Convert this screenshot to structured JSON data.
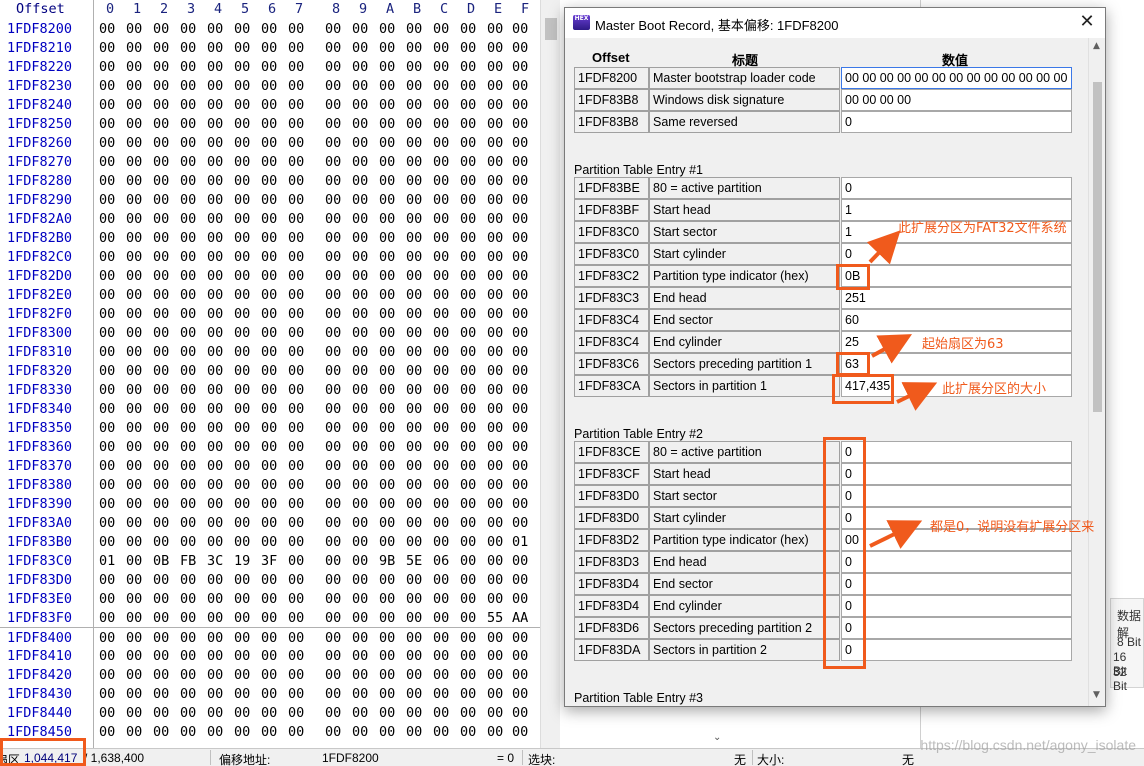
{
  "hex_editor": {
    "offset_header": "Offset",
    "column_headers": [
      "0",
      "1",
      "2",
      "3",
      "4",
      "5",
      "6",
      "7",
      "8",
      "9",
      "A",
      "B",
      "C",
      "D",
      "E",
      "F"
    ],
    "rows": [
      {
        "addr": "1FDF8200",
        "bytes": [
          "00",
          "00",
          "00",
          "00",
          "00",
          "00",
          "00",
          "00",
          "00",
          "00",
          "00",
          "00",
          "00",
          "00",
          "00",
          "00"
        ]
      },
      {
        "addr": "1FDF8210",
        "bytes": [
          "00",
          "00",
          "00",
          "00",
          "00",
          "00",
          "00",
          "00",
          "00",
          "00",
          "00",
          "00",
          "00",
          "00",
          "00",
          "00"
        ]
      },
      {
        "addr": "1FDF8220",
        "bytes": [
          "00",
          "00",
          "00",
          "00",
          "00",
          "00",
          "00",
          "00",
          "00",
          "00",
          "00",
          "00",
          "00",
          "00",
          "00",
          "00"
        ]
      },
      {
        "addr": "1FDF8230",
        "bytes": [
          "00",
          "00",
          "00",
          "00",
          "00",
          "00",
          "00",
          "00",
          "00",
          "00",
          "00",
          "00",
          "00",
          "00",
          "00",
          "00"
        ]
      },
      {
        "addr": "1FDF8240",
        "bytes": [
          "00",
          "00",
          "00",
          "00",
          "00",
          "00",
          "00",
          "00",
          "00",
          "00",
          "00",
          "00",
          "00",
          "00",
          "00",
          "00"
        ]
      },
      {
        "addr": "1FDF8250",
        "bytes": [
          "00",
          "00",
          "00",
          "00",
          "00",
          "00",
          "00",
          "00",
          "00",
          "00",
          "00",
          "00",
          "00",
          "00",
          "00",
          "00"
        ]
      },
      {
        "addr": "1FDF8260",
        "bytes": [
          "00",
          "00",
          "00",
          "00",
          "00",
          "00",
          "00",
          "00",
          "00",
          "00",
          "00",
          "00",
          "00",
          "00",
          "00",
          "00"
        ]
      },
      {
        "addr": "1FDF8270",
        "bytes": [
          "00",
          "00",
          "00",
          "00",
          "00",
          "00",
          "00",
          "00",
          "00",
          "00",
          "00",
          "00",
          "00",
          "00",
          "00",
          "00"
        ]
      },
      {
        "addr": "1FDF8280",
        "bytes": [
          "00",
          "00",
          "00",
          "00",
          "00",
          "00",
          "00",
          "00",
          "00",
          "00",
          "00",
          "00",
          "00",
          "00",
          "00",
          "00"
        ]
      },
      {
        "addr": "1FDF8290",
        "bytes": [
          "00",
          "00",
          "00",
          "00",
          "00",
          "00",
          "00",
          "00",
          "00",
          "00",
          "00",
          "00",
          "00",
          "00",
          "00",
          "00"
        ]
      },
      {
        "addr": "1FDF82A0",
        "bytes": [
          "00",
          "00",
          "00",
          "00",
          "00",
          "00",
          "00",
          "00",
          "00",
          "00",
          "00",
          "00",
          "00",
          "00",
          "00",
          "00"
        ]
      },
      {
        "addr": "1FDF82B0",
        "bytes": [
          "00",
          "00",
          "00",
          "00",
          "00",
          "00",
          "00",
          "00",
          "00",
          "00",
          "00",
          "00",
          "00",
          "00",
          "00",
          "00"
        ]
      },
      {
        "addr": "1FDF82C0",
        "bytes": [
          "00",
          "00",
          "00",
          "00",
          "00",
          "00",
          "00",
          "00",
          "00",
          "00",
          "00",
          "00",
          "00",
          "00",
          "00",
          "00"
        ]
      },
      {
        "addr": "1FDF82D0",
        "bytes": [
          "00",
          "00",
          "00",
          "00",
          "00",
          "00",
          "00",
          "00",
          "00",
          "00",
          "00",
          "00",
          "00",
          "00",
          "00",
          "00"
        ]
      },
      {
        "addr": "1FDF82E0",
        "bytes": [
          "00",
          "00",
          "00",
          "00",
          "00",
          "00",
          "00",
          "00",
          "00",
          "00",
          "00",
          "00",
          "00",
          "00",
          "00",
          "00"
        ]
      },
      {
        "addr": "1FDF82F0",
        "bytes": [
          "00",
          "00",
          "00",
          "00",
          "00",
          "00",
          "00",
          "00",
          "00",
          "00",
          "00",
          "00",
          "00",
          "00",
          "00",
          "00"
        ]
      },
      {
        "addr": "1FDF8300",
        "bytes": [
          "00",
          "00",
          "00",
          "00",
          "00",
          "00",
          "00",
          "00",
          "00",
          "00",
          "00",
          "00",
          "00",
          "00",
          "00",
          "00"
        ]
      },
      {
        "addr": "1FDF8310",
        "bytes": [
          "00",
          "00",
          "00",
          "00",
          "00",
          "00",
          "00",
          "00",
          "00",
          "00",
          "00",
          "00",
          "00",
          "00",
          "00",
          "00"
        ]
      },
      {
        "addr": "1FDF8320",
        "bytes": [
          "00",
          "00",
          "00",
          "00",
          "00",
          "00",
          "00",
          "00",
          "00",
          "00",
          "00",
          "00",
          "00",
          "00",
          "00",
          "00"
        ]
      },
      {
        "addr": "1FDF8330",
        "bytes": [
          "00",
          "00",
          "00",
          "00",
          "00",
          "00",
          "00",
          "00",
          "00",
          "00",
          "00",
          "00",
          "00",
          "00",
          "00",
          "00"
        ]
      },
      {
        "addr": "1FDF8340",
        "bytes": [
          "00",
          "00",
          "00",
          "00",
          "00",
          "00",
          "00",
          "00",
          "00",
          "00",
          "00",
          "00",
          "00",
          "00",
          "00",
          "00"
        ]
      },
      {
        "addr": "1FDF8350",
        "bytes": [
          "00",
          "00",
          "00",
          "00",
          "00",
          "00",
          "00",
          "00",
          "00",
          "00",
          "00",
          "00",
          "00",
          "00",
          "00",
          "00"
        ]
      },
      {
        "addr": "1FDF8360",
        "bytes": [
          "00",
          "00",
          "00",
          "00",
          "00",
          "00",
          "00",
          "00",
          "00",
          "00",
          "00",
          "00",
          "00",
          "00",
          "00",
          "00"
        ]
      },
      {
        "addr": "1FDF8370",
        "bytes": [
          "00",
          "00",
          "00",
          "00",
          "00",
          "00",
          "00",
          "00",
          "00",
          "00",
          "00",
          "00",
          "00",
          "00",
          "00",
          "00"
        ]
      },
      {
        "addr": "1FDF8380",
        "bytes": [
          "00",
          "00",
          "00",
          "00",
          "00",
          "00",
          "00",
          "00",
          "00",
          "00",
          "00",
          "00",
          "00",
          "00",
          "00",
          "00"
        ]
      },
      {
        "addr": "1FDF8390",
        "bytes": [
          "00",
          "00",
          "00",
          "00",
          "00",
          "00",
          "00",
          "00",
          "00",
          "00",
          "00",
          "00",
          "00",
          "00",
          "00",
          "00"
        ]
      },
      {
        "addr": "1FDF83A0",
        "bytes": [
          "00",
          "00",
          "00",
          "00",
          "00",
          "00",
          "00",
          "00",
          "00",
          "00",
          "00",
          "00",
          "00",
          "00",
          "00",
          "00"
        ]
      },
      {
        "addr": "1FDF83B0",
        "bytes": [
          "00",
          "00",
          "00",
          "00",
          "00",
          "00",
          "00",
          "00",
          "00",
          "00",
          "00",
          "00",
          "00",
          "00",
          "00",
          "01"
        ]
      },
      {
        "addr": "1FDF83C0",
        "bytes": [
          "01",
          "00",
          "0B",
          "FB",
          "3C",
          "19",
          "3F",
          "00",
          "00",
          "00",
          "9B",
          "5E",
          "06",
          "00",
          "00",
          "00"
        ]
      },
      {
        "addr": "1FDF83D0",
        "bytes": [
          "00",
          "00",
          "00",
          "00",
          "00",
          "00",
          "00",
          "00",
          "00",
          "00",
          "00",
          "00",
          "00",
          "00",
          "00",
          "00"
        ]
      },
      {
        "addr": "1FDF83E0",
        "bytes": [
          "00",
          "00",
          "00",
          "00",
          "00",
          "00",
          "00",
          "00",
          "00",
          "00",
          "00",
          "00",
          "00",
          "00",
          "00",
          "00"
        ]
      },
      {
        "addr": "1FDF83F0",
        "bytes": [
          "00",
          "00",
          "00",
          "00",
          "00",
          "00",
          "00",
          "00",
          "00",
          "00",
          "00",
          "00",
          "00",
          "00",
          "55",
          "AA"
        ]
      },
      {
        "addr": "1FDF8400",
        "bytes": [
          "00",
          "00",
          "00",
          "00",
          "00",
          "00",
          "00",
          "00",
          "00",
          "00",
          "00",
          "00",
          "00",
          "00",
          "00",
          "00"
        ]
      },
      {
        "addr": "1FDF8410",
        "bytes": [
          "00",
          "00",
          "00",
          "00",
          "00",
          "00",
          "00",
          "00",
          "00",
          "00",
          "00",
          "00",
          "00",
          "00",
          "00",
          "00"
        ]
      },
      {
        "addr": "1FDF8420",
        "bytes": [
          "00",
          "00",
          "00",
          "00",
          "00",
          "00",
          "00",
          "00",
          "00",
          "00",
          "00",
          "00",
          "00",
          "00",
          "00",
          "00"
        ]
      },
      {
        "addr": "1FDF8430",
        "bytes": [
          "00",
          "00",
          "00",
          "00",
          "00",
          "00",
          "00",
          "00",
          "00",
          "00",
          "00",
          "00",
          "00",
          "00",
          "00",
          "00"
        ]
      },
      {
        "addr": "1FDF8440",
        "bytes": [
          "00",
          "00",
          "00",
          "00",
          "00",
          "00",
          "00",
          "00",
          "00",
          "00",
          "00",
          "00",
          "00",
          "00",
          "00",
          "00"
        ]
      },
      {
        "addr": "1FDF8450",
        "bytes": [
          "00",
          "00",
          "00",
          "00",
          "00",
          "00",
          "00",
          "00",
          "00",
          "00",
          "00",
          "00",
          "00",
          "00",
          "00",
          "00"
        ]
      }
    ]
  },
  "info_panel": {
    "title": "数据解",
    "lines": [
      "8 Bit",
      "16 Bit",
      "32 Bit"
    ]
  },
  "status_bar": {
    "sector_label": "扇区",
    "sector_value": "1,044,417",
    "sector_total": "/ 1,638,400",
    "offset_label": "偏移地址:",
    "offset_value": "1FDF8200",
    "equals_value": "= 0",
    "selection_label": "选块:",
    "selection_value": "无",
    "size_label": "大小:",
    "size_value": "无"
  },
  "watermark": "https://blog.csdn.net/agony_isolate",
  "dialog": {
    "icon_text": "HEX",
    "title": "Master Boot Record, 基本偏移: 1FDF8200",
    "close_glyph": "✕",
    "headers": {
      "offset": "Offset",
      "title": "标题",
      "value": "数值"
    },
    "header_rows": [
      {
        "offset": "1FDF8200",
        "label": "Master bootstrap loader code",
        "value": "00 00 00 00 00 00 00 00 00 00 00 00 00 00 00 00"
      },
      {
        "offset": "1FDF83B8",
        "label": "Windows disk signature",
        "value": "00 00 00 00"
      },
      {
        "offset": "1FDF83B8",
        "label": "Same reversed",
        "value": "0"
      }
    ],
    "partition1": {
      "heading": "Partition Table Entry #1",
      "rows": [
        {
          "offset": "1FDF83BE",
          "label": "80 = active partition",
          "value": "0"
        },
        {
          "offset": "1FDF83BF",
          "label": "Start head",
          "value": "1"
        },
        {
          "offset": "1FDF83C0",
          "label": "Start sector",
          "value": "1"
        },
        {
          "offset": "1FDF83C0",
          "label": "Start cylinder",
          "value": "0"
        },
        {
          "offset": "1FDF83C2",
          "label": "Partition type indicator (hex)",
          "value": "0B"
        },
        {
          "offset": "1FDF83C3",
          "label": "End head",
          "value": "251"
        },
        {
          "offset": "1FDF83C4",
          "label": "End sector",
          "value": "60"
        },
        {
          "offset": "1FDF83C4",
          "label": "End cylinder",
          "value": "25"
        },
        {
          "offset": "1FDF83C6",
          "label": "Sectors preceding partition 1",
          "value": "63"
        },
        {
          "offset": "1FDF83CA",
          "label": "Sectors in partition 1",
          "value": "417,435"
        }
      ]
    },
    "partition2": {
      "heading": "Partition Table Entry #2",
      "rows": [
        {
          "offset": "1FDF83CE",
          "label": "80 = active partition",
          "value": "0"
        },
        {
          "offset": "1FDF83CF",
          "label": "Start head",
          "value": "0"
        },
        {
          "offset": "1FDF83D0",
          "label": "Start sector",
          "value": "0"
        },
        {
          "offset": "1FDF83D0",
          "label": "Start cylinder",
          "value": "0"
        },
        {
          "offset": "1FDF83D2",
          "label": "Partition type indicator (hex)",
          "value": "00"
        },
        {
          "offset": "1FDF83D3",
          "label": "End head",
          "value": "0"
        },
        {
          "offset": "1FDF83D4",
          "label": "End sector",
          "value": "0"
        },
        {
          "offset": "1FDF83D4",
          "label": "End cylinder",
          "value": "0"
        },
        {
          "offset": "1FDF83D6",
          "label": "Sectors preceding partition 2",
          "value": "0"
        },
        {
          "offset": "1FDF83DA",
          "label": "Sectors in partition 2",
          "value": "0"
        }
      ]
    },
    "partition3": {
      "heading": "Partition Table Entry #3"
    }
  },
  "annotations": {
    "fat32": "此扩展分区为FAT32文件系统",
    "start_sector": "起始扇区为63",
    "size": "此扩展分区的大小",
    "all_zero": "都是0，说明没有扩展分区来"
  },
  "colors": {
    "annotation": "#f05a1c",
    "hex_address": "#0000c0",
    "focus_border": "#3b78e7"
  }
}
